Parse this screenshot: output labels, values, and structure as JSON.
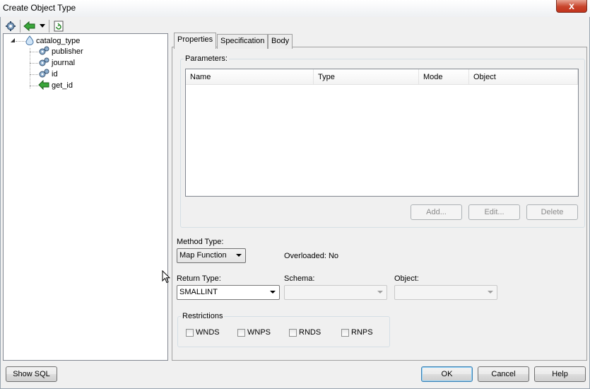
{
  "window": {
    "title": "Create Object Type",
    "close_glyph": "x"
  },
  "toolbar": {
    "icons": [
      "add-attribute-icon",
      "add-method-icon",
      "dropdown-arrow-icon",
      "refresh-icon"
    ]
  },
  "tree": {
    "root": "catalog_type",
    "children": [
      {
        "label": "publisher",
        "icon": "attribute-gear-icon"
      },
      {
        "label": "journal",
        "icon": "attribute-gear-icon"
      },
      {
        "label": "id",
        "icon": "attribute-gear-icon"
      },
      {
        "label": "get_id",
        "icon": "method-green-arrow-icon"
      }
    ]
  },
  "tabs": [
    "Properties",
    "Specification",
    "Body"
  ],
  "parameters": {
    "legend": "Parameters:",
    "columns": [
      "Name",
      "Type",
      "Mode",
      "Object"
    ],
    "buttons": {
      "add": "Add...",
      "edit": "Edit...",
      "delete": "Delete"
    }
  },
  "method_type": {
    "label": "Method Type:",
    "value": "Map Function"
  },
  "overloaded": "Overloaded: No",
  "return_type": {
    "label": "Return Type:",
    "value": "SMALLINT"
  },
  "schema": {
    "label": "Schema:",
    "value": ""
  },
  "object": {
    "label": "Object:",
    "value": ""
  },
  "restrictions": {
    "legend": "Restrictions",
    "items": [
      "WNDS",
      "WNPS",
      "RNDS",
      "RNPS"
    ]
  },
  "footer": {
    "show_sql": "Show SQL",
    "ok": "OK",
    "cancel": "Cancel",
    "help": "Help"
  }
}
